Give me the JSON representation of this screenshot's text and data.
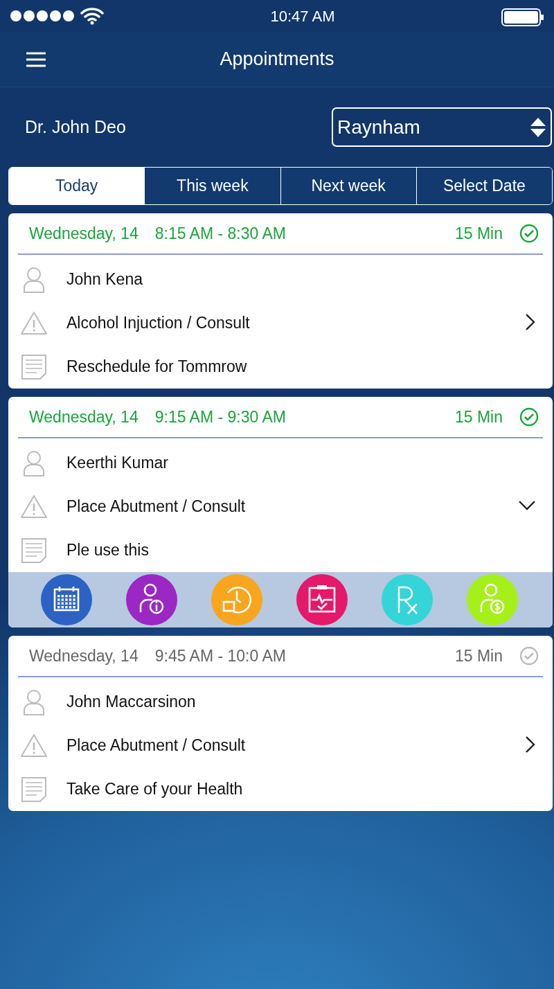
{
  "status_bar": {
    "time": "10:47 AM"
  },
  "header": {
    "title": "Appointments"
  },
  "doctor": "Dr. John Deo",
  "location_select": {
    "value": "Raynham"
  },
  "tabs": [
    {
      "label": "Today",
      "selected": true
    },
    {
      "label": "This week",
      "selected": false
    },
    {
      "label": "Next week",
      "selected": false
    },
    {
      "label": "Select Date",
      "selected": false
    }
  ],
  "appointments": [
    {
      "date": "Wednesday, 14",
      "time": "8:15 AM - 8:30 AM",
      "duration": "15 Min",
      "confirmed": true,
      "expanded": false,
      "patient": "John Kena",
      "procedure": "Alcohol Injuction / Consult",
      "note": "Reschedule for Tommrow"
    },
    {
      "date": "Wednesday, 14",
      "time": "9:15 AM - 9:30 AM",
      "duration": "15 Min",
      "confirmed": true,
      "expanded": true,
      "patient": "Keerthi Kumar",
      "procedure": "Place Abutment / Consult",
      "note": "Ple use this",
      "actions": [
        {
          "kind": "calendar",
          "color": "#2b62c4"
        },
        {
          "kind": "patient-info",
          "color": "#9b27c4"
        },
        {
          "kind": "reschedule",
          "color": "#f9a51d"
        },
        {
          "kind": "chart",
          "color": "#e5186a"
        },
        {
          "kind": "prescription",
          "color": "#34d5d8"
        },
        {
          "kind": "billing",
          "color": "#a6f01a"
        }
      ]
    },
    {
      "date": "Wednesday, 14",
      "time": "9:45 AM - 10:0 AM",
      "duration": "15 Min",
      "confirmed": false,
      "expanded": false,
      "patient": "John Maccarsinon",
      "procedure": "Place Abutment / Consult",
      "note": "Take Care of your Health"
    }
  ]
}
